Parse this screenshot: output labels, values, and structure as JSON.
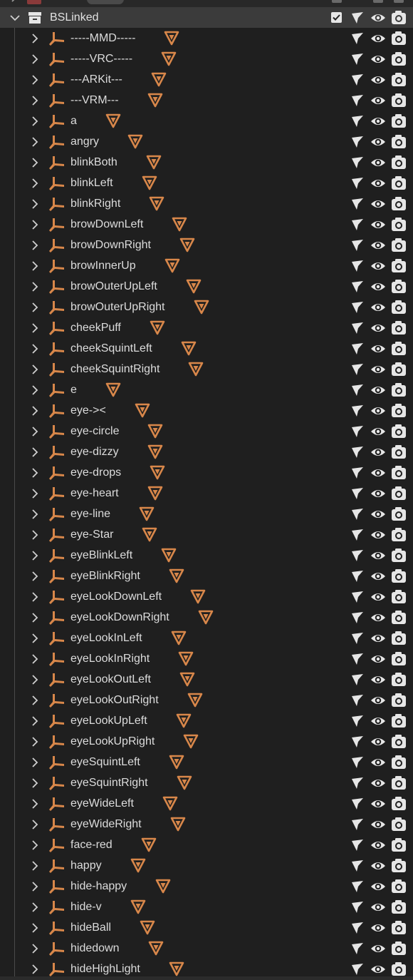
{
  "collection": {
    "name": "BSLinked",
    "checked": true
  },
  "colors": {
    "background": "#1f1f1f",
    "header_bg": "#3b3b3b",
    "armature_orange": "#d8874a",
    "shape_orange": "#d8874a",
    "icon_white": "#e6e6e6"
  },
  "row_icons": [
    "chevron-right-icon",
    "armature-icon",
    "shape-triangle-icon",
    "select-cursor-icon",
    "eye-icon",
    "camera-icon"
  ],
  "items": [
    "-----MMD-----",
    "-----VRC-----",
    "---ARKit---",
    "---VRM---",
    "a",
    "angry",
    "blinkBoth",
    "blinkLeft",
    "blinkRight",
    "browDownLeft",
    "browDownRight",
    "browInnerUp",
    "browOuterUpLeft",
    "browOuterUpRight",
    "cheekPuff",
    "cheekSquintLeft",
    "cheekSquintRight",
    "e",
    "eye-><",
    "eye-circle",
    "eye-dizzy",
    "eye-drops",
    "eye-heart",
    "eye-line",
    "eye-Star",
    "eyeBlinkLeft",
    "eyeBlinkRight",
    "eyeLookDownLeft",
    "eyeLookDownRight",
    "eyeLookInLeft",
    "eyeLookInRight",
    "eyeLookOutLeft",
    "eyeLookOutRight",
    "eyeLookUpLeft",
    "eyeLookUpRight",
    "eyeSquintLeft",
    "eyeSquintRight",
    "eyeWideLeft",
    "eyeWideRight",
    "face-red",
    "happy",
    "hide-happy",
    "hide-v",
    "hideBall",
    "hidedown",
    "hideHighLight"
  ]
}
